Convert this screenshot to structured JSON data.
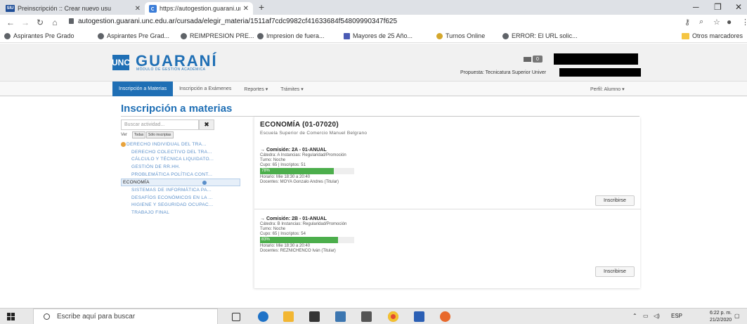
{
  "browser": {
    "tabs": [
      {
        "title": "Preinscripción :: Crear nuevo usu",
        "favicon": "SIU",
        "active": false
      },
      {
        "title": "https://autogestion.guarani.unc",
        "active": true
      }
    ],
    "url": "autogestion.guarani.unc.edu.ar/cursada/elegir_materia/1511af7cdc9982cf41633684f54809990347f625",
    "bookmarks": [
      "Aspirantes Pre Grado",
      "Aspirantes Pre Grad...",
      "REIMPRESION PRE...",
      "Impresion de fuera...",
      "Mayores de 25 Año...",
      "Turnos Online",
      "ERROR: El URL solic..."
    ],
    "other_bookmarks": "Otros marcadores"
  },
  "header": {
    "logo_unc": "UNC",
    "logo_name": "GUARANÍ",
    "logo_subtitle": "MÓDULO DE GESTIÓN ACADÉMICA",
    "mail_count": "0",
    "propuesta": "Propuesta: Tecnicatura Superior Univer"
  },
  "nav": {
    "items": [
      "Inscripción a Materias",
      "Inscripción a Exámenes",
      "Reportes ▾",
      "Trámites ▾"
    ],
    "perfil": "Perfil: Alumno ▾"
  },
  "page": {
    "title": "Inscripción a materias",
    "search_placeholder": "Buscar actividad...",
    "clear_label": "✖",
    "ver_label": "Ver",
    "filter_all": "Todas",
    "filter_inscriptas": "Sólo inscriptas"
  },
  "activities": [
    "DERECHO INDIVIDUAL DEL TRA...",
    "DERECHO COLECTIVO DEL TRA...",
    "CÁLCULO Y TÉCNICA LIQUIDATO...",
    "GESTIÓN DE RR.HH.",
    "PROBLEMÁTICA POLÍTICA CONT...",
    "ECONOMÍA",
    "SISTEMAS DE INFORMÁTICA PA...",
    "DESAFÍOS ECONÓMICOS EN LA ...",
    "HIGIENE Y SEGURIDAD OCUPAC...",
    "TRABAJO FINAL"
  ],
  "detail": {
    "title": "ECONOMÍA (01-07020)",
    "school": "Escuela Superior de Comercio Manuel Belgrano",
    "comisiones": [
      {
        "title": "→ Comisión: 2A - 01-ANUAL",
        "catedra": "Cátedra: A Instancias: Regularidad/Promoción",
        "turno": "Turno: Noche",
        "cupo": "Cupo: 65 | Inscriptos: 51",
        "percent_label": "78%",
        "percent": 78,
        "horario": "Horario: Mie 18:30 a 20:40",
        "docentes": "Docentes: MOYA Gonzalo Andres (Titular)",
        "button": "Inscribirse"
      },
      {
        "title": "→ Comisión: 2B - 01-ANUAL",
        "catedra": "Cátedra: B Instancias: Regularidad/Promoción",
        "turno": "Turno: Noche",
        "cupo": "Cupo: 65 | Inscriptos: 54",
        "percent_label": "83%",
        "percent": 83,
        "horario": "Horario: Mie 18:30 a 20:40",
        "docentes": "Docentes: REZNICHENCO Iván (Titular)",
        "button": "Inscribirse"
      }
    ]
  },
  "taskbar": {
    "search": "Escribe aquí para buscar",
    "lang": "ESP",
    "time": "6:22 p. m.",
    "date": "21/2/2020"
  },
  "colors": {
    "brand": "#1f6fb5",
    "progress": "#4cae4c",
    "link": "#5a8fca"
  }
}
